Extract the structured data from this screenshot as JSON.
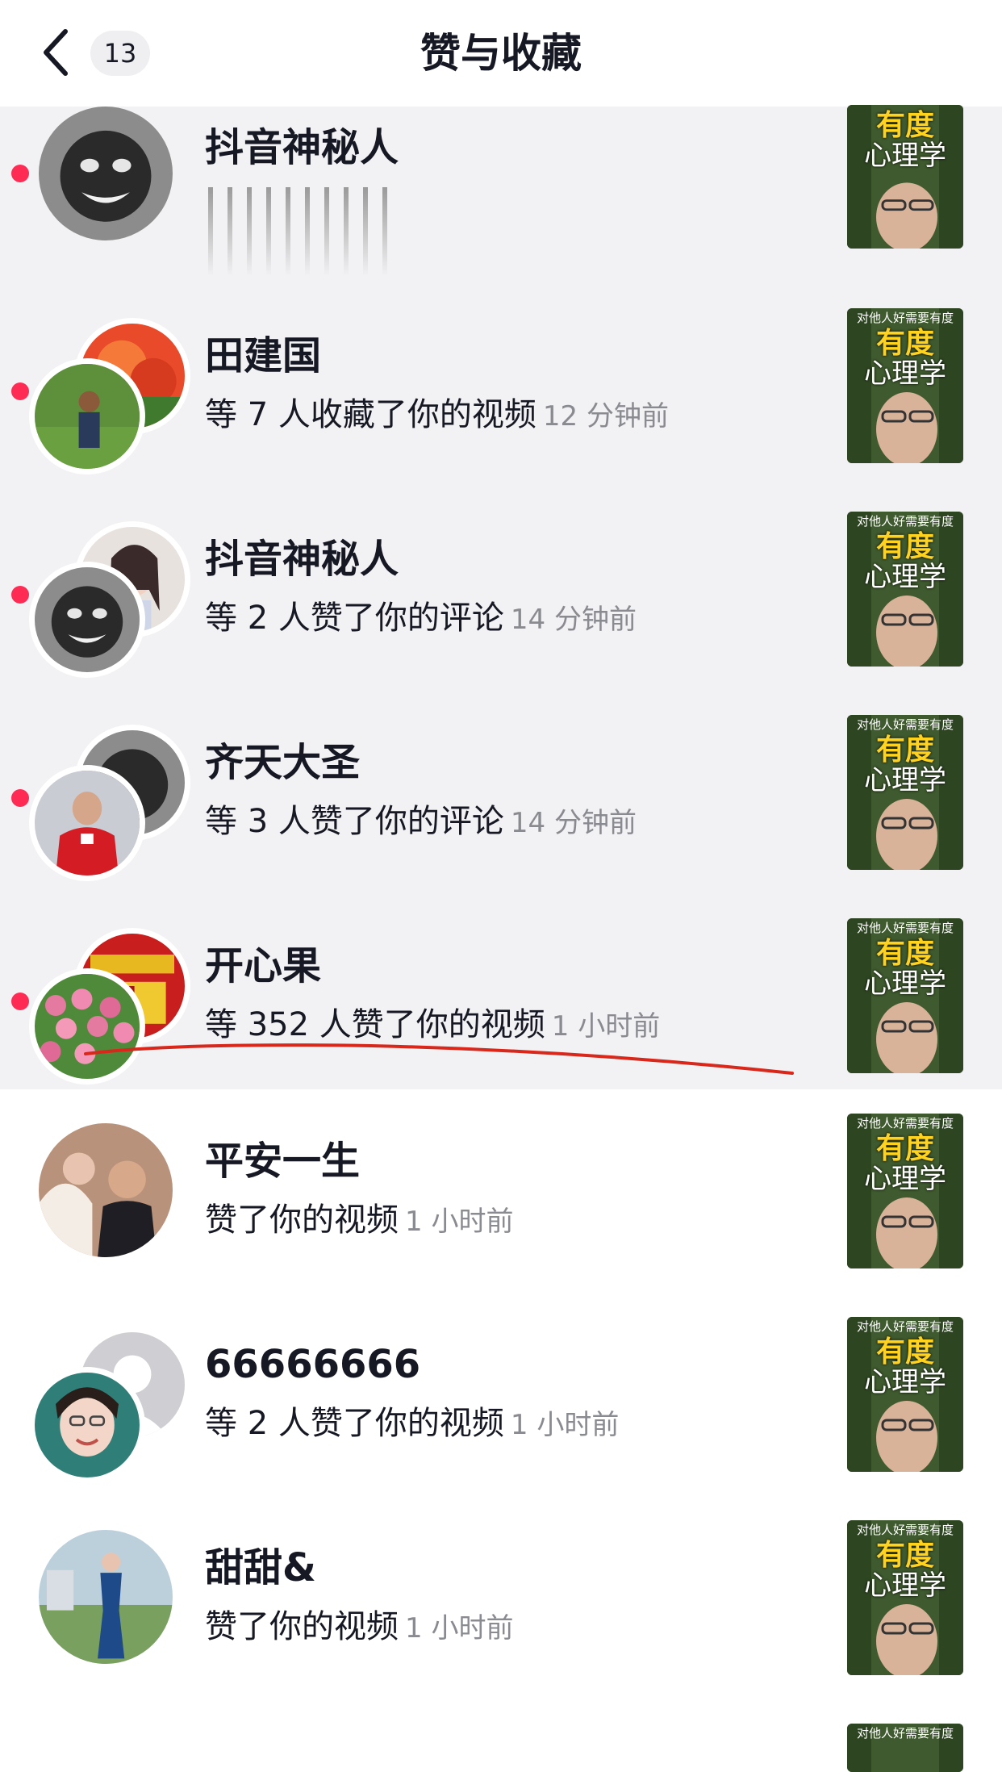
{
  "header": {
    "title": "赞与收藏",
    "badge_count": "13"
  },
  "thumbnail": {
    "caption": "对他人好需要有度",
    "line1": "有度",
    "line2": "心理学"
  },
  "colors": {
    "unread_dot": "#fe2c55",
    "unread_bg": "#f2f2f4",
    "annotation_line": "#d8281c",
    "thumb_title": "#ffd21e"
  },
  "items": [
    {
      "name": "抖音神秘人",
      "desc": "",
      "time": "",
      "unread": true
    },
    {
      "name": "田建国",
      "desc": "等 7 人收藏了你的视频",
      "time": "12 分钟前",
      "unread": true
    },
    {
      "name": "抖音神秘人",
      "desc": "等 2 人赞了你的评论",
      "time": "14 分钟前",
      "unread": true
    },
    {
      "name": "齐天大圣",
      "desc": "等 3 人赞了你的评论",
      "time": "14 分钟前",
      "unread": true
    },
    {
      "name": "开心果",
      "desc": "等 352 人赞了你的视频",
      "time": "1 小时前",
      "unread": true
    },
    {
      "name": "平安一生",
      "desc": "赞了你的视频",
      "time": "1 小时前",
      "unread": false
    },
    {
      "name": "66666666",
      "desc": "等 2 人赞了你的视频",
      "time": "1 小时前",
      "unread": false
    },
    {
      "name": "甜甜&",
      "desc": "赞了你的视频",
      "time": "1 小时前",
      "unread": false
    }
  ]
}
